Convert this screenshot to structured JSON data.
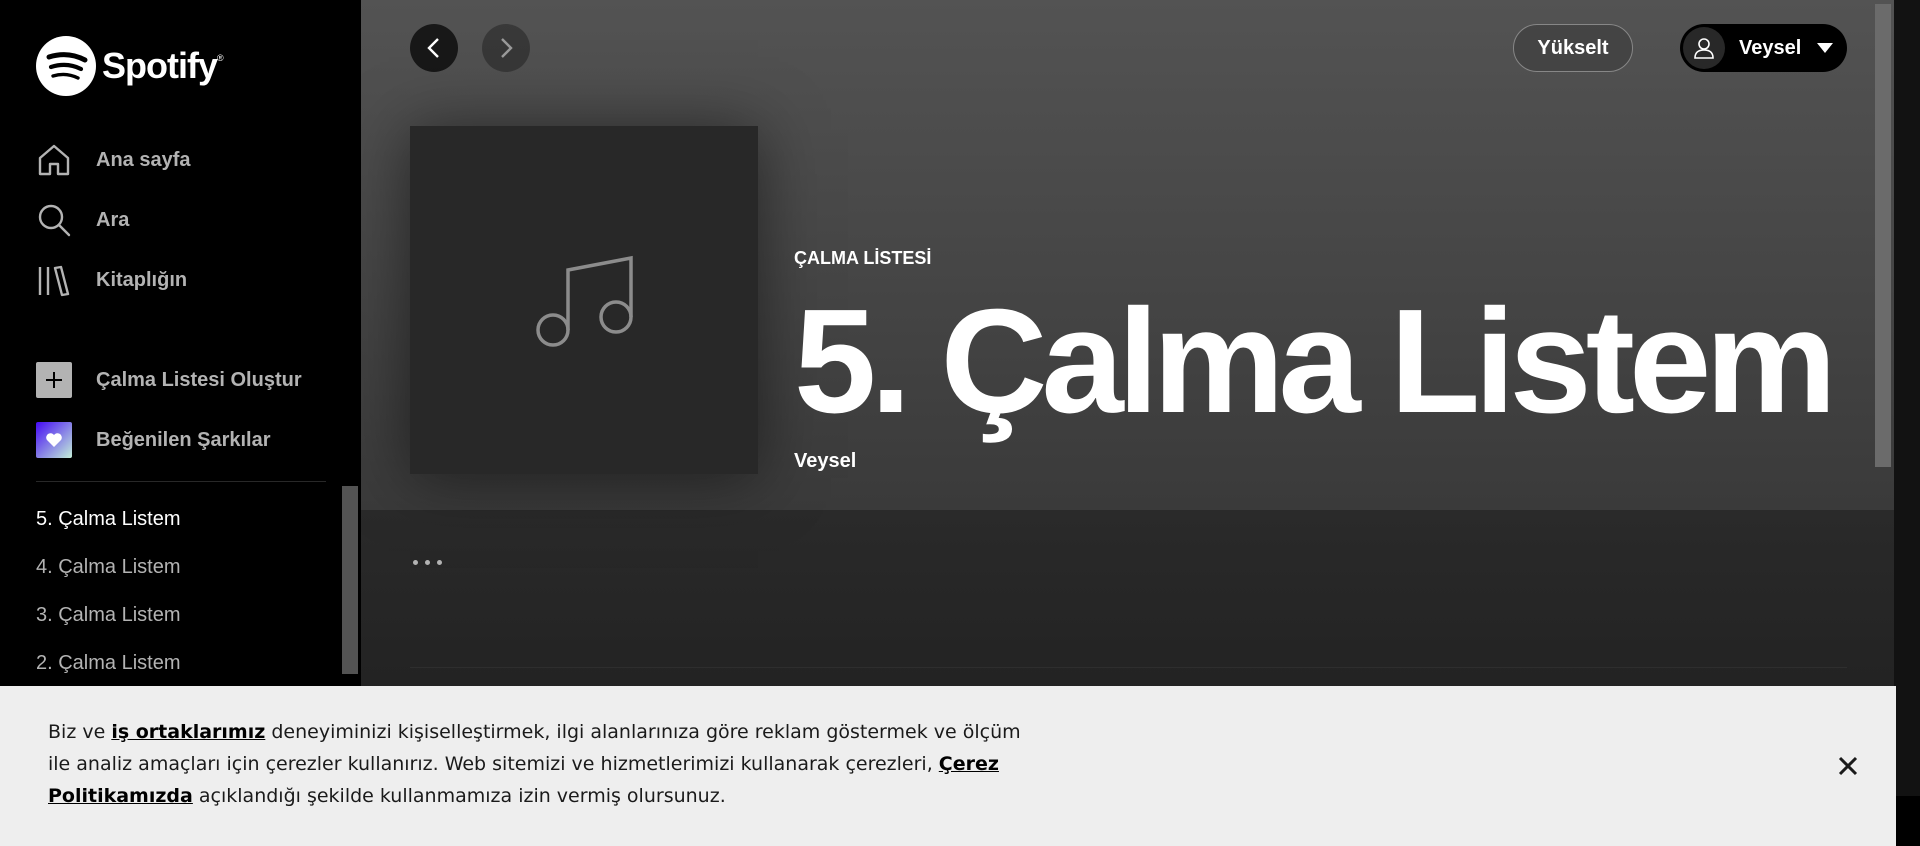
{
  "app": {
    "name": "Spotify"
  },
  "sidebar": {
    "nav": [
      {
        "label": "Ana sayfa",
        "icon": "home-icon"
      },
      {
        "label": "Ara",
        "icon": "search-icon"
      },
      {
        "label": "Kitaplığın",
        "icon": "library-icon"
      }
    ],
    "actions": [
      {
        "label": "Çalma Listesi Oluştur",
        "icon": "plus-icon"
      },
      {
        "label": "Beğenilen Şarkılar",
        "icon": "heart-icon"
      }
    ],
    "playlists": [
      {
        "label": "5. Çalma Listem",
        "active": true
      },
      {
        "label": "4. Çalma Listem",
        "active": false
      },
      {
        "label": "3. Çalma Listem",
        "active": false
      },
      {
        "label": "2. Çalma Listem",
        "active": false
      }
    ]
  },
  "header": {
    "upgrade_label": "Yükselt",
    "user_name": "Veysel"
  },
  "playlist": {
    "type": "ÇALMA LİSTESİ",
    "title": "5. Çalma Listem",
    "owner": "Veysel"
  },
  "cookie": {
    "part1": "Biz ve ",
    "link1": "iş ortaklarımız",
    "part2": " deneyiminizi kişiselleştirmek, ilgi alanlarınıza göre reklam göstermek ve ölçüm ile analiz amaçları için çerezler kullanırız. Web sitemizi ve hizmetlerimizi kullanarak çerezleri, ",
    "link2": "Çerez Politikamızda",
    "part3": " açıklandığı şekilde kullanmamıza izin vermiş olursunuz."
  },
  "colors": {
    "sidebar_bg": "#000000",
    "main_bg": "#121212",
    "text_muted": "#b3b3b3",
    "cookie_bg": "#eeeeee"
  }
}
